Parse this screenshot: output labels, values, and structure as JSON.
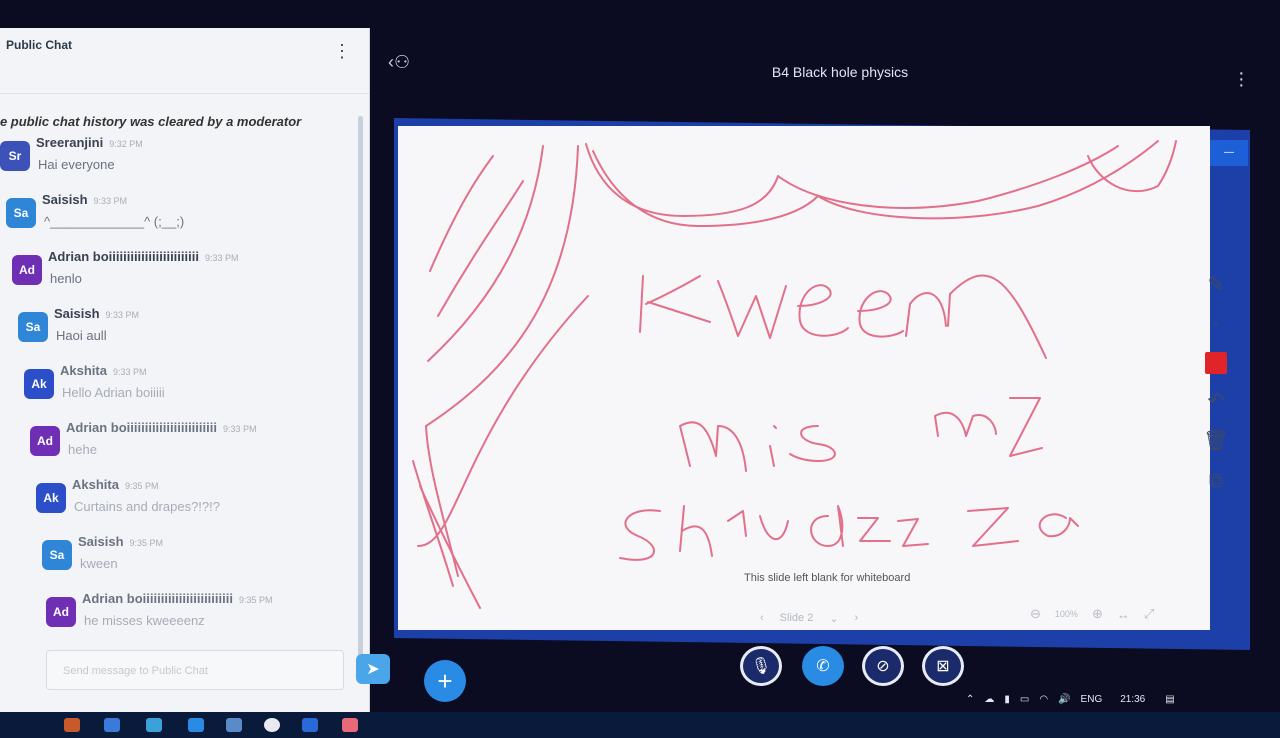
{
  "chat": {
    "title": "Public Chat",
    "system_message": "he public chat history was cleared by a moderator",
    "composer_placeholder": "Send message to Public Chat",
    "messages": [
      {
        "initials": "Sr",
        "name": "Sreeranjini",
        "time": "9:32 PM",
        "text": "Hai everyone",
        "color": "#3d52b8"
      },
      {
        "initials": "Sa",
        "name": "Saisish",
        "time": "9:33 PM",
        "text": "^_____________^ (;__;)",
        "color": "#2f86d6"
      },
      {
        "initials": "Ad",
        "name": "Adrian boiiiiiiiiiiiiiiiiiiiiiiiii",
        "time": "9:33 PM",
        "text": "henlo",
        "color": "#6e2fb5"
      },
      {
        "initials": "Sa",
        "name": "Saisish",
        "time": "9:33 PM",
        "text": "Haoi aull",
        "color": "#2f86d6"
      },
      {
        "initials": "Ak",
        "name": "Akshita",
        "time": "9:33 PM",
        "text": "Hello Adrian boiiiii",
        "color": "#2d4ec9"
      },
      {
        "initials": "Ad",
        "name": "Adrian boiiiiiiiiiiiiiiiiiiiiiiiii",
        "time": "9:33 PM",
        "text": "hehe",
        "color": "#6e2fb5"
      },
      {
        "initials": "Ak",
        "name": "Akshita",
        "time": "9:35 PM",
        "text": "Curtains and drapes?!?!?",
        "color": "#2d4ec9"
      },
      {
        "initials": "Sa",
        "name": "Saisish",
        "time": "9:35 PM",
        "text": "kween",
        "color": "#2f86d6"
      },
      {
        "initials": "Ad",
        "name": "Adrian boiiiiiiiiiiiiiiiiiiiiiiiii",
        "time": "9:35 PM",
        "text": "he misses kweeeenz",
        "color": "#6e2fb5"
      }
    ]
  },
  "presentation": {
    "title": "B4 Black hole physics",
    "blank_caption": "This slide left blank for whiteboard",
    "slide_label": "Slide 2",
    "zoom_label": "100%",
    "ink_color": "#e2708a"
  },
  "tray": {
    "lang": "ENG",
    "clock": "21:36"
  },
  "icons": {
    "user_toggle": "user-icon",
    "pencil": "pencil-icon",
    "undo": "undo-icon",
    "trash": "trash-icon",
    "multiuser": "chart-icon",
    "mic": "mic-muted-icon",
    "phone": "phone-icon",
    "camera": "camera-off-icon",
    "screen": "screen-share-off-icon",
    "plus": "plus-icon",
    "send": "send-icon"
  }
}
